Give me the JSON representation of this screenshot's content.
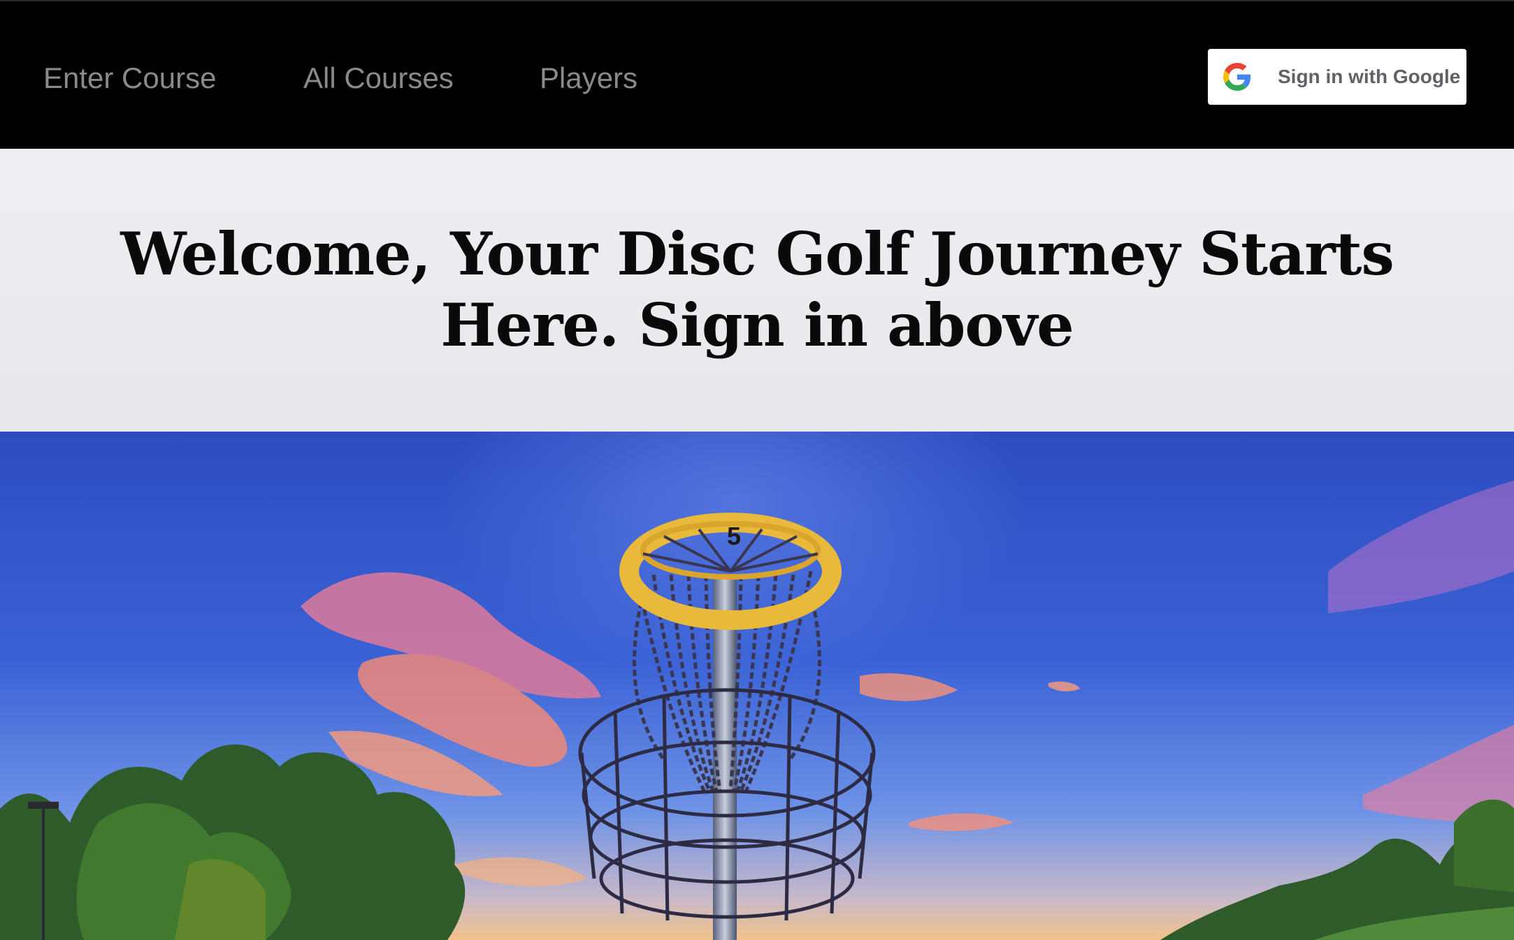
{
  "navbar": {
    "links": [
      {
        "label": "Enter Course"
      },
      {
        "label": "All Courses"
      },
      {
        "label": "Players"
      }
    ],
    "google_signin": {
      "label": "Sign in with Google",
      "icon": "google-g-icon"
    }
  },
  "hero": {
    "title_line1": "Welcome, Your Disc Golf Journey Starts",
    "title_line2": "Here. Sign in above"
  },
  "photo": {
    "basket_number": "5"
  },
  "colors": {
    "navbar_bg": "#000000",
    "nav_link": "#8a8a8a",
    "hero_bg": "#ecedf0",
    "sky_top": "#2f4fc4",
    "basket_yellow": "#e8b93a"
  }
}
